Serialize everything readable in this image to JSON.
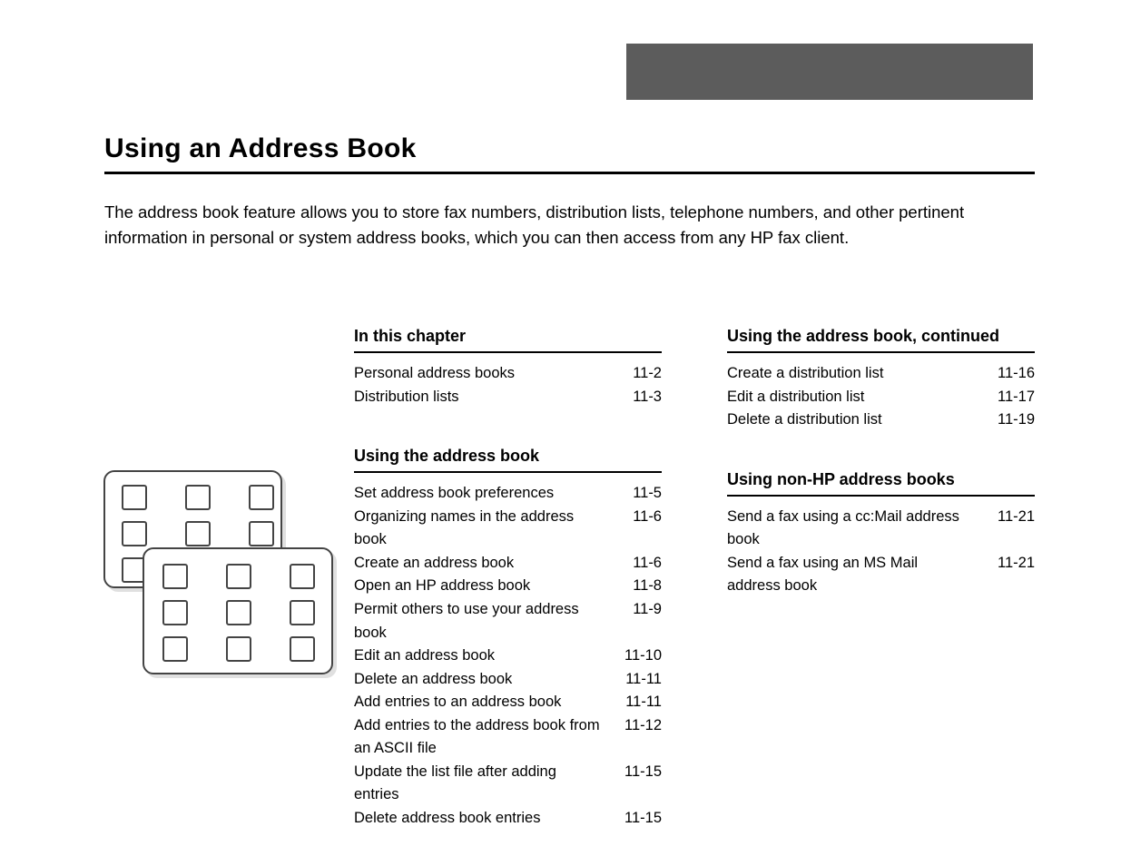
{
  "chapter_title": "Using an Address Book",
  "summary": "The address book feature allows you to store fax numbers, distribution lists, telephone numbers, and other pertinent information in personal or system address books, which you can then access from any HP fax client.",
  "toc": {
    "left": {
      "section1": {
        "heading": "In this chapter",
        "items": [
          {
            "label": "Personal address books",
            "page": "11-2"
          },
          {
            "label": "Distribution lists",
            "page": "11-3"
          }
        ]
      },
      "section2": {
        "heading": "Using the address book",
        "items": [
          {
            "label": "Set address book preferences",
            "page": "11-5"
          },
          {
            "label": "Organizing names in the address book",
            "page": "11-6"
          },
          {
            "label": "Create an address book",
            "page": "11-6"
          },
          {
            "label": "Open an HP address book",
            "page": "11-8"
          },
          {
            "label": "Permit others to use your address book",
            "page": "11-9"
          },
          {
            "label": "Edit an address book",
            "page": "11-10"
          },
          {
            "label": "Delete an address book",
            "page": "11-11"
          },
          {
            "label": "Add entries to an address book",
            "page": "11-11"
          },
          {
            "label": "Add entries to the address book from an ASCII file",
            "page": "11-12"
          },
          {
            "label": "Update the list file after adding entries",
            "page": "11-15"
          },
          {
            "label": "Delete address book entries",
            "page": "11-15"
          }
        ]
      }
    },
    "right": {
      "section1": {
        "heading": "Using the address book, continued",
        "items": [
          {
            "label": "Create a distribution list",
            "page": "11-16"
          },
          {
            "label": "Edit a distribution list",
            "page": "11-17"
          },
          {
            "label": "Delete a distribution list",
            "page": "11-19"
          }
        ]
      },
      "section2": {
        "heading": "Using non-HP address books",
        "items": [
          {
            "label": "Send a fax using a cc:Mail address book",
            "page": "11-21"
          },
          {
            "label": "Send a fax using an MS Mail address book",
            "page": "11-21"
          }
        ]
      }
    }
  }
}
